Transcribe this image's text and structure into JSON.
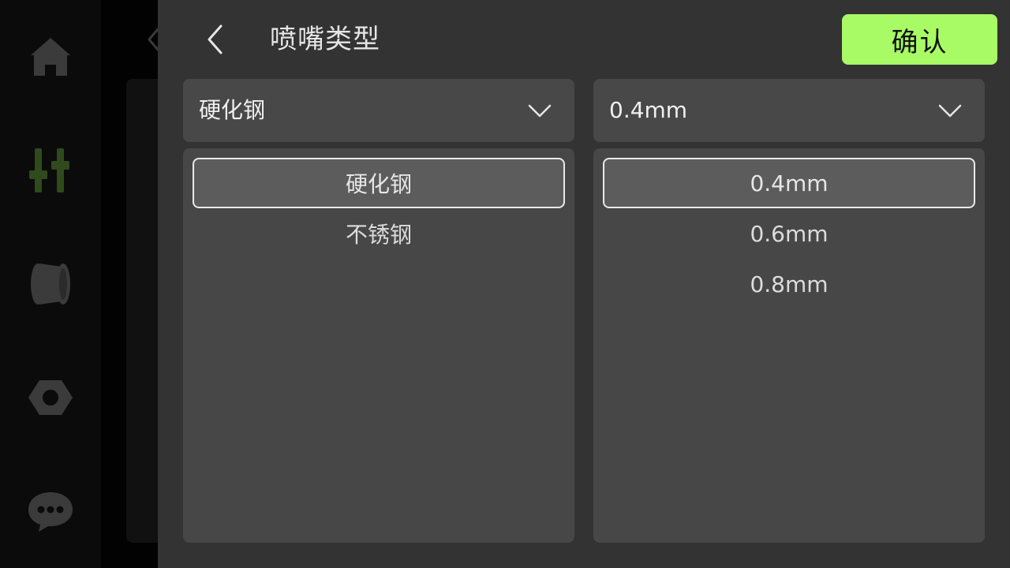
{
  "nav": {
    "items": [
      {
        "icon": "home-icon"
      },
      {
        "icon": "controls-sliders-icon",
        "active": true
      },
      {
        "icon": "filament-spool-icon"
      },
      {
        "icon": "settings-nut-icon"
      },
      {
        "icon": "chat-bubble-icon"
      }
    ]
  },
  "dialog": {
    "title": "喷嘴类型",
    "confirm_label": "确认",
    "material": {
      "selected": "硬化钢",
      "options": [
        "硬化钢",
        "不锈钢"
      ]
    },
    "diameter": {
      "selected": "0.4mm",
      "options": [
        "0.4mm",
        "0.6mm",
        "0.8mm"
      ]
    }
  },
  "colors": {
    "accent": "#a8fb64",
    "nav_active": "#2f4a1c",
    "nav_inactive": "#3b3b3b",
    "panel": "#333333",
    "card": "#484848"
  }
}
